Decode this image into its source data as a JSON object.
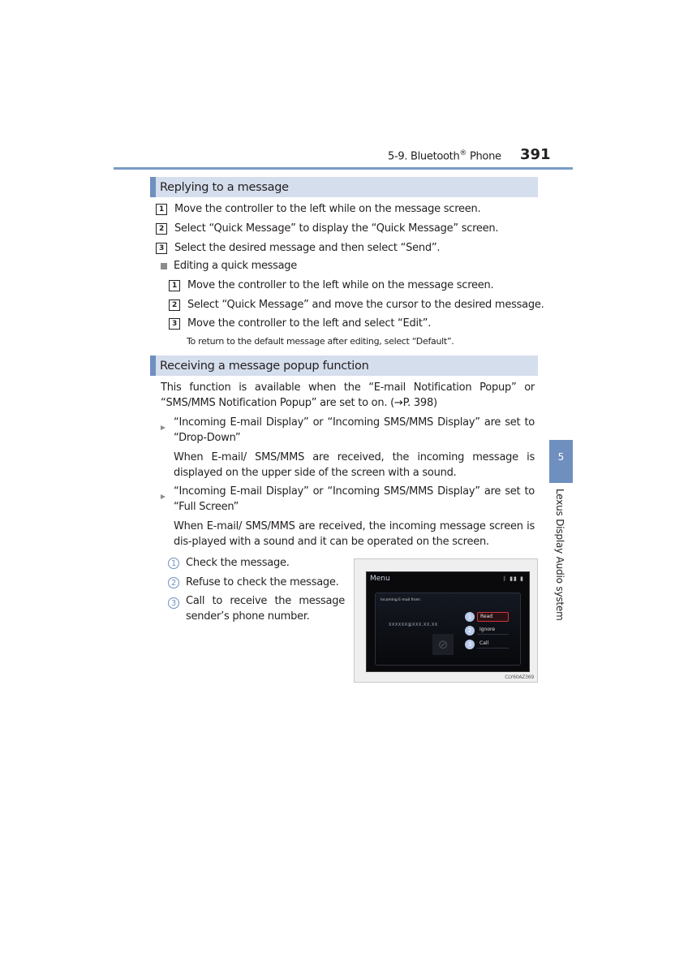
{
  "header": {
    "section": "5-9. Bluetooth",
    "section_mark": "®",
    "section_suffix": " Phone",
    "page_number": "391"
  },
  "section1": {
    "title": "Replying to a message",
    "steps": [
      {
        "num": "1",
        "text": "Move the controller to the left while on the message screen."
      },
      {
        "num": "2",
        "text": "Select “Quick Message” to display the “Quick Message” screen."
      },
      {
        "num": "3",
        "text": "Select the desired message and then select “Send”."
      }
    ],
    "subsection": {
      "title": "Editing a quick message",
      "steps": [
        {
          "num": "1",
          "text": "Move the controller to the left while on the message screen."
        },
        {
          "num": "2",
          "text": "Select “Quick Message” and move the cursor to the desired message."
        },
        {
          "num": "3",
          "text": "Move the controller to the left and select “Edit”."
        }
      ],
      "note": "To return to the default message after editing, select “Default”."
    }
  },
  "section2": {
    "title": "Receiving a message popup function",
    "intro": "This function is available when the “E-mail Notification Popup” or “SMS/MMS Notification Popup” are set to on. (→P. 398)",
    "bullets": [
      {
        "condition": "“Incoming E-mail Display” or “Incoming SMS/MMS Display” are set to “Drop-Down”",
        "description": "When E-mail/ SMS/MMS are received, the incoming message is displayed on the upper side of the screen with a sound."
      },
      {
        "condition": "“Incoming E-mail Display” or “Incoming SMS/MMS Display” are set to “Full Screen”",
        "description": "When E-mail/ SMS/MMS are received, the incoming message screen is dis-played with a sound and it can be operated on the screen."
      }
    ],
    "callouts": [
      {
        "num": "1",
        "text": "Check the message."
      },
      {
        "num": "2",
        "text": "Refuse to check the message."
      },
      {
        "num": "3",
        "text": "Call to receive the message sender’s phone number."
      }
    ]
  },
  "screen": {
    "menu_label": "Menu",
    "status_icons": "bluetooth-icon signal-icon battery-icon",
    "status_glyphs": "ᛒ ▮▮ ▮",
    "from_label": "Incoming E-mail from:",
    "sender_number": "XXXXXX@XXX.XX.XX",
    "no_image_glyph": "⃠",
    "buttons": [
      {
        "num": "1",
        "label": "Read",
        "selected": true
      },
      {
        "num": "2",
        "label": "Ignore",
        "selected": false
      },
      {
        "num": "3",
        "label": "Call",
        "selected": false
      }
    ],
    "figure_code": "CLY60AZ369"
  },
  "side_tab": {
    "chapter": "5",
    "label": "Lexus Display Audio system"
  },
  "colors": {
    "accent": "#6f8fbf",
    "section_bar_bg": "#d5deed",
    "header_rule": "#7a9cc6"
  }
}
